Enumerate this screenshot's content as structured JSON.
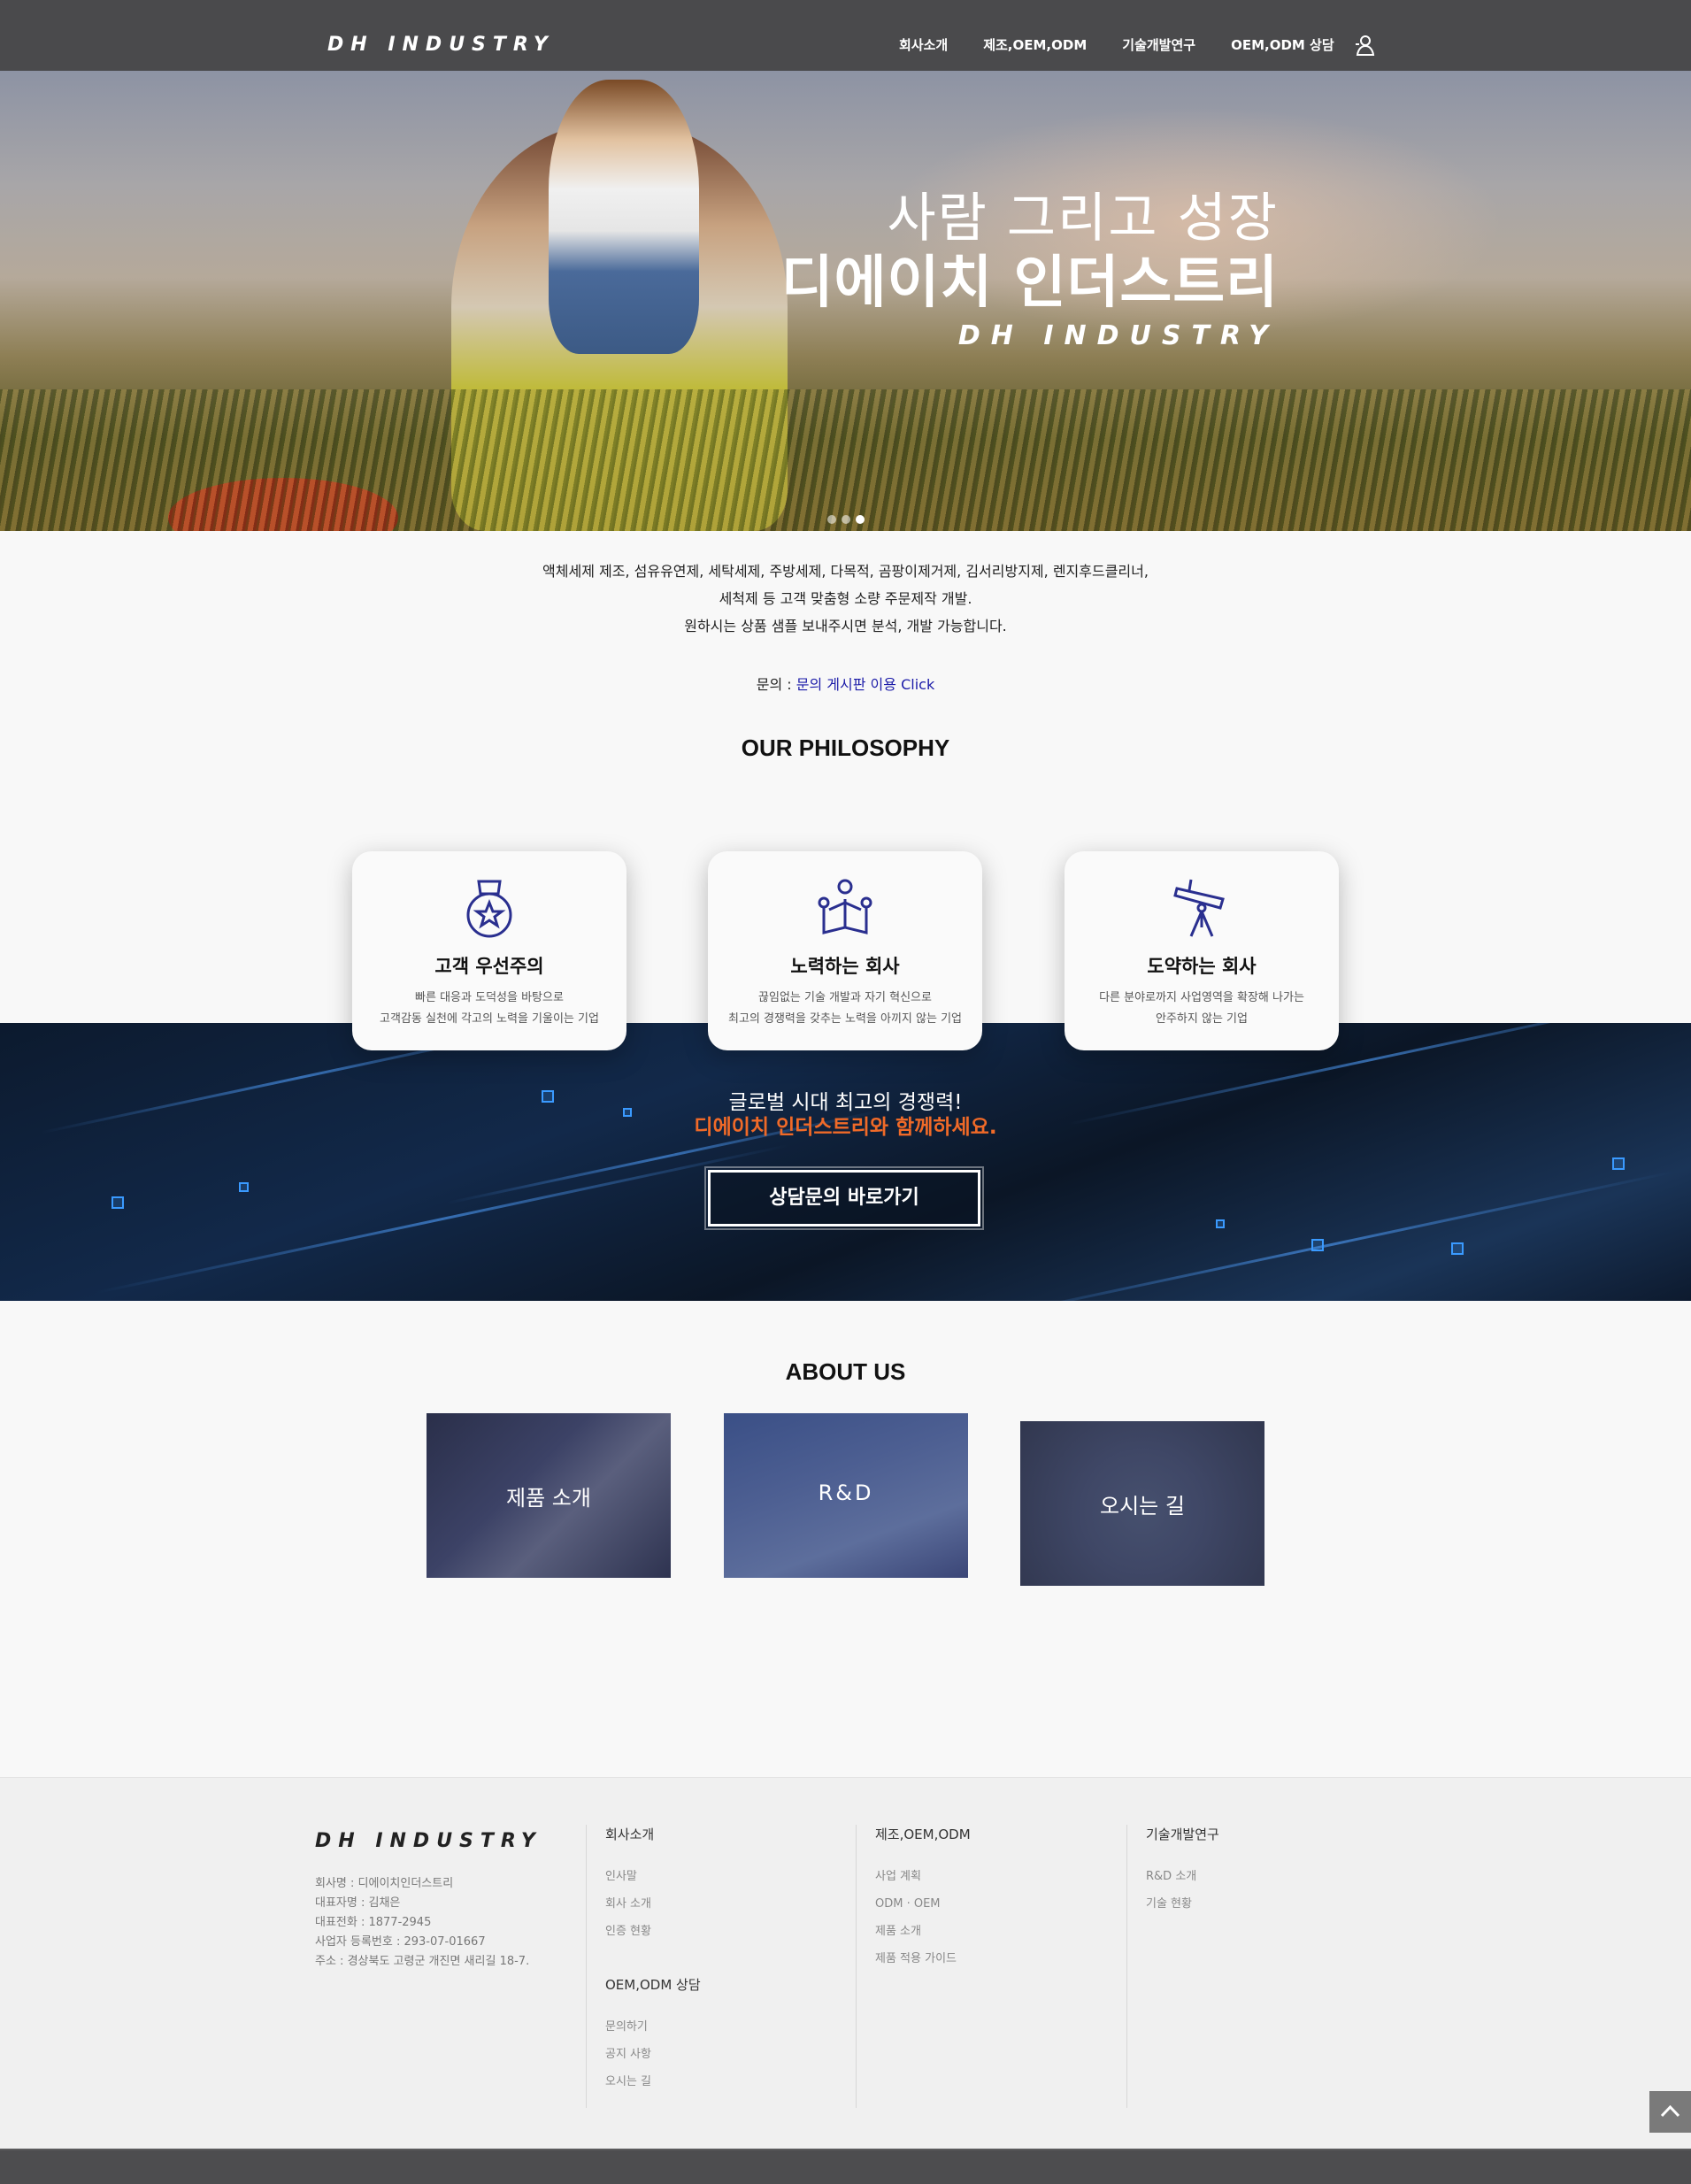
{
  "header": {
    "logo": "DH INDUSTRY",
    "nav": [
      "회사소개",
      "제조,OEM,ODM",
      "기술개발연구",
      "OEM,ODM 상담"
    ],
    "user_icon": "user-icon"
  },
  "hero": {
    "line1": "사람 그리고 성장",
    "line2": "디에이치 인더스트리",
    "line3": "DH INDUSTRY",
    "slides": 3,
    "active_slide": 3
  },
  "intro": {
    "line1": "액체세제 제조, 섬유유연제, 세탁세제, 주방세제, 다목적, 곰팡이제거제, 김서리방지제, 렌지후드클리너,",
    "line2": "세척제 등 고객 맞춤형 소량 주문제작 개발.",
    "line3": "원하시는 상품 샘플 보내주시면 분석, 개발 가능합니다.",
    "inquiry_prefix": "문의 :",
    "inquiry_link": "문의 게시판 이용 Click"
  },
  "philosophy": {
    "title": "OUR PHILOSOPHY",
    "cards": [
      {
        "icon": "medal-star-icon",
        "title": "고객 우선주의",
        "desc1": "빠른 대응과 도덕성을 바탕으로",
        "desc2": "고객감동 실천에 각고의 노력을 기울이는 기업"
      },
      {
        "icon": "person-reading-book-icon",
        "title": "노력하는 회사",
        "desc1": "끊임없는 기술 개발과 자기 혁신으로",
        "desc2": "최고의 경쟁력을 갖추는 노력을 아끼지 않는 기업"
      },
      {
        "icon": "telescope-icon",
        "title": "도약하는 회사",
        "desc1": "다른 분야로까지 사업영역을 확장해 나가는",
        "desc2": "안주하지 않는 기업"
      }
    ]
  },
  "band": {
    "line1": "글로벌 시대 최고의 경쟁력!",
    "line2": "디에이치 인더스트리와 함께하세요.",
    "button": "상담문의 바로가기"
  },
  "about": {
    "title": "ABOUT US",
    "items": [
      "제품 소개",
      "R&D",
      "오시는 길"
    ]
  },
  "footer": {
    "logo": "DH INDUSTRY",
    "info": [
      "회사명 : 디에이치인더스트리",
      "대표자명 : 김채은",
      "대표전화 : 1877-2945",
      "사업자 등록번호 : 293-07-01667",
      "주소 : 경상북도 고령군 개진면 새리길 18-7."
    ],
    "col1": {
      "title": "회사소개",
      "links": [
        "인사말",
        "회사 소개",
        "인증 현황"
      ],
      "title2": "OEM,ODM 상담",
      "links2": [
        "문의하기",
        "공지 사항",
        "오시는 길"
      ]
    },
    "col2": {
      "title": "제조,OEM,ODM",
      "links": [
        "사업 계획",
        "ODM · OEM",
        "제품 소개",
        "제품 적용 가이드"
      ]
    },
    "col3": {
      "title": "기술개발연구",
      "links": [
        "R&D 소개",
        "기술 현황"
      ]
    }
  },
  "colors": {
    "header_bg": "#4a4a4c",
    "accent_orange": "#f06a28",
    "icon_blue": "#2a2f8f",
    "link_blue": "#1a1aa8"
  }
}
